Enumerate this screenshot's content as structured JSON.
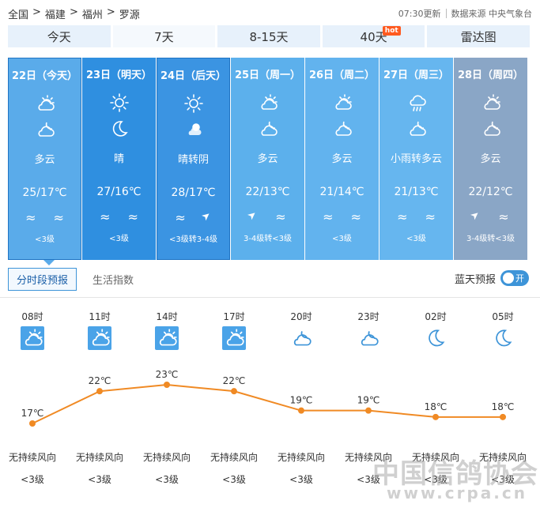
{
  "breadcrumb": [
    "全国",
    "福建",
    "福州",
    "罗源"
  ],
  "meta": {
    "updated": "07:30更新",
    "source": "数据来源 中央气象台"
  },
  "tabs": [
    {
      "label": "今天",
      "badge": ""
    },
    {
      "label": "7天",
      "badge": ""
    },
    {
      "label": "8-15天",
      "badge": ""
    },
    {
      "label": "40天",
      "badge": "hot"
    },
    {
      "label": "雷达图",
      "badge": ""
    }
  ],
  "days": [
    {
      "date": "22日（今天）",
      "desc": "多云",
      "temp": "25/17℃",
      "wind": "<3级",
      "day_icon": "partly-cloudy-day-icon",
      "night_icon": "partly-cloudy-night-icon",
      "wind_icons": [
        "wave-icon",
        "wave-icon"
      ],
      "bg": "#5aabea",
      "selected": true
    },
    {
      "date": "23日（明天）",
      "desc": "晴",
      "temp": "27/16℃",
      "wind": "<3级",
      "day_icon": "sun-icon",
      "night_icon": "moon-icon",
      "wind_icons": [
        "wave-icon",
        "wave-icon"
      ],
      "bg": "#2f8fe0",
      "selected": false
    },
    {
      "date": "24日（后天）",
      "desc": "晴转阴",
      "temp": "28/17℃",
      "wind": "<3级转3-4级",
      "day_icon": "sun-icon",
      "night_icon": "cloud-moon-icon",
      "wind_icons": [
        "wave-icon",
        "arrow-icon"
      ],
      "bg": "#3b94e2",
      "selected": true
    },
    {
      "date": "25日（周一）",
      "desc": "多云",
      "temp": "22/13℃",
      "wind": "3-4级转<3级",
      "day_icon": "partly-cloudy-day-icon",
      "night_icon": "partly-cloudy-night-icon",
      "wind_icons": [
        "arrow-icon",
        "wave-icon"
      ],
      "bg": "#5cb0ec",
      "selected": false
    },
    {
      "date": "26日（周二）",
      "desc": "多云",
      "temp": "21/14℃",
      "wind": "<3级",
      "day_icon": "partly-cloudy-day-icon",
      "night_icon": "partly-cloudy-night-icon",
      "wind_icons": [
        "wave-icon",
        "wave-icon"
      ],
      "bg": "#62b3ee",
      "selected": false
    },
    {
      "date": "27日（周三）",
      "desc": "小雨转多云",
      "temp": "21/13℃",
      "wind": "<3级",
      "day_icon": "rain-icon",
      "night_icon": "partly-cloudy-night-icon",
      "wind_icons": [
        "wave-icon",
        "wave-icon"
      ],
      "bg": "#66b6ef",
      "selected": false
    },
    {
      "date": "28日（周四）",
      "desc": "多云",
      "temp": "22/12℃",
      "wind": "3-4级转<3级",
      "day_icon": "partly-cloudy-day-icon",
      "night_icon": "partly-cloudy-night-icon",
      "wind_icons": [
        "arrow-icon",
        "wave-icon"
      ],
      "bg": "#8aa6c6",
      "selected": false
    }
  ],
  "subtabs": [
    "分时段预报",
    "生活指数"
  ],
  "clear_sky": {
    "label": "蓝天预报",
    "toggle": "开"
  },
  "hourly": [
    {
      "time": "08时",
      "temp": 17,
      "icon": "partly-cloudy-day-icon",
      "wind_dir": "无持续风向",
      "wind_lv": "<3级"
    },
    {
      "time": "11时",
      "temp": 22,
      "icon": "partly-cloudy-day-icon",
      "wind_dir": "无持续风向",
      "wind_lv": "<3级"
    },
    {
      "time": "14时",
      "temp": 23,
      "icon": "partly-cloudy-day-icon",
      "wind_dir": "无持续风向",
      "wind_lv": "<3级"
    },
    {
      "time": "17时",
      "temp": 22,
      "icon": "partly-cloudy-day-icon",
      "wind_dir": "无持续风向",
      "wind_lv": "<3级"
    },
    {
      "time": "20时",
      "temp": 19,
      "icon": "cloud-night-icon",
      "wind_dir": "无持续风向",
      "wind_lv": "<3级"
    },
    {
      "time": "23时",
      "temp": 19,
      "icon": "cloud-night-icon",
      "wind_dir": "无持续风向",
      "wind_lv": "<3级"
    },
    {
      "time": "02时",
      "temp": 18,
      "icon": "moon-icon",
      "wind_dir": "无持续风向",
      "wind_lv": "<3级"
    },
    {
      "time": "05时",
      "temp": 18,
      "icon": "moon-icon",
      "wind_dir": "无持续风向",
      "wind_lv": "<3级"
    }
  ],
  "temp_unit": "℃",
  "line_color": "#f08a24",
  "watermark": {
    "line1": "中国信鸽协会",
    "line2": "www.crpa.cn"
  }
}
